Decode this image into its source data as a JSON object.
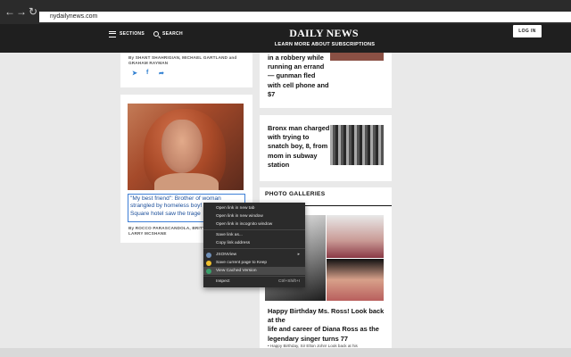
{
  "browser": {
    "url": "nydailynews.com",
    "icons": [
      "back-arrow-icon",
      "forward-arrow-icon",
      "reload-icon"
    ]
  },
  "header": {
    "sections_label": "SECTIONS",
    "search_label": "SEARCH",
    "logo_text": "DAILY NEWS",
    "subscriptions_label": "LEARN MORE ABOUT SUBSCRIPTIONS",
    "login_label": "LOG IN"
  },
  "left_column": {
    "card1": {
      "byline": [
        "By SHANT SHAHRIGIAN, MICHAEL GARTLAND and",
        "GRAHAM RAYMAN"
      ],
      "share_icons": [
        "twitter-icon",
        "facebook-icon",
        "share-icon"
      ]
    },
    "card2": {
      "title_lines": [
        "\"My best friend\": Brother of woman",
        "strangled by homeless boyf",
        "Square hotel saw the trage"
      ],
      "byline": [
        "By ROCCO PARASCANDOLA, BRITTAN",
        "LARRY MCSHANE"
      ]
    }
  },
  "right_column": {
    "story1": {
      "title_lines": [
        "in a robbery while",
        "running an errand",
        "— gunman fled",
        "with cell phone and",
        "$7"
      ]
    },
    "story2": {
      "title_lines": [
        "Bronx man charged",
        "with trying to",
        "snatch boy, 8, from",
        "mom in subway",
        "station"
      ]
    },
    "galleries": {
      "label": "PHOTO GALLERIES",
      "headline_lines": [
        "Happy Birthday Ms. Ross! Look back at the",
        "life and career of Diana Ross as the",
        "legendary singer turns 77"
      ],
      "next_item": "• Happy Birthday, Sir Elton John! Look back at his"
    }
  },
  "context_menu": {
    "items": [
      {
        "label": "Open link in new tab"
      },
      {
        "label": "Open link in new window"
      },
      {
        "label": "Open link in incognito window"
      },
      {
        "label": "Save link as..."
      },
      {
        "label": "Copy link address"
      },
      {
        "label": "JSONView",
        "has_submenu": true
      },
      {
        "label": "Save current page to Keep"
      },
      {
        "label": "View Cached Version"
      },
      {
        "label": "Inspect",
        "shortcut": "Ctrl+Shift+I"
      }
    ],
    "highlighted_index": 7
  },
  "colors": {
    "header_bg": "#1f1f1f",
    "link_blue": "#3d7fd6",
    "menu_bg": "#2b2b2b"
  }
}
